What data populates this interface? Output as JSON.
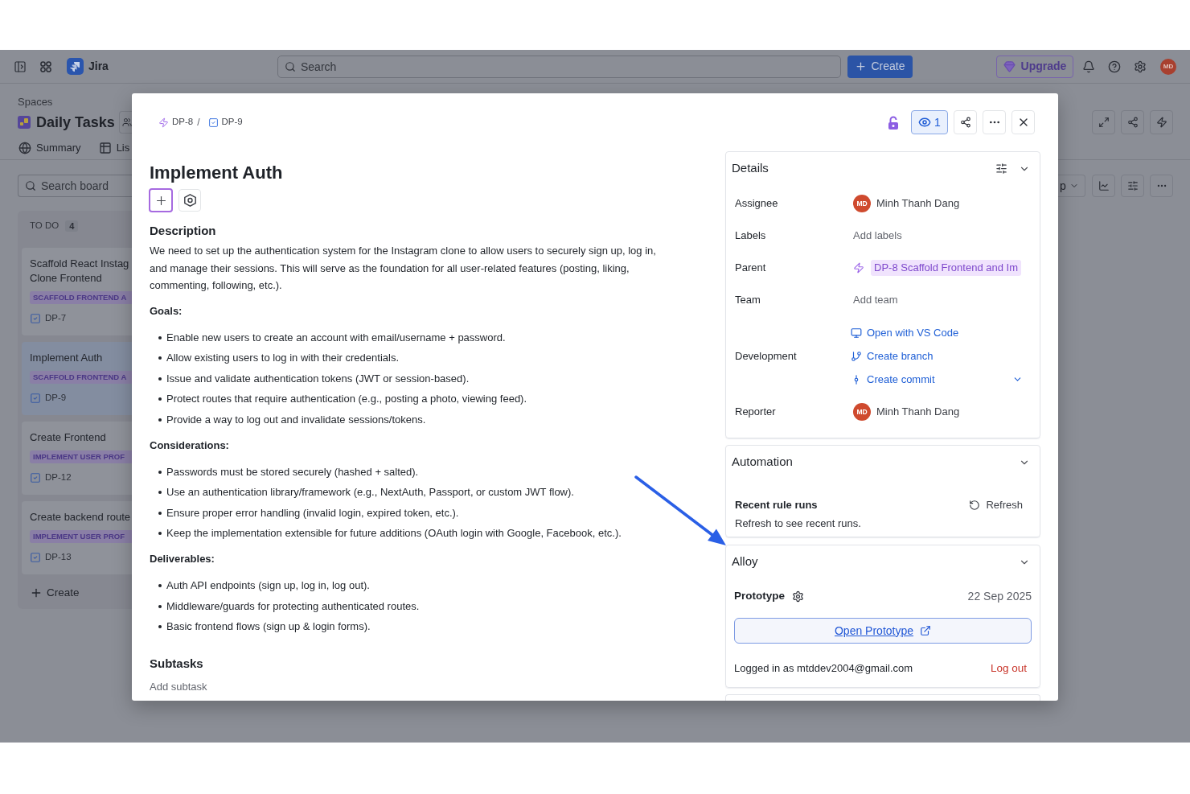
{
  "top_bar": {
    "product": "Jira",
    "search": {
      "placeholder": "Search"
    },
    "create_button": "Create",
    "upgrade_button": "Upgrade",
    "avatar": "MD"
  },
  "space_header": {
    "breadcrumb": "Spaces",
    "title": "Daily Tasks",
    "tabs": [
      {
        "label": "Summary",
        "selected": false
      },
      {
        "label": "Lis",
        "selected": false
      }
    ]
  },
  "board": {
    "search": {
      "placeholder": "Search board"
    },
    "column": {
      "title": "TO DO",
      "count": "4",
      "cards": [
        {
          "title_lines": [
            "Scaffold React Instag",
            "Clone Frontend"
          ],
          "tag": "SCAFFOLD FRONTEND A",
          "key": "DP-7",
          "selected": false
        },
        {
          "title_lines": [
            "Implement Auth"
          ],
          "tag": "SCAFFOLD FRONTEND A",
          "key": "DP-9",
          "selected": true
        },
        {
          "title_lines": [
            "Create Frontend"
          ],
          "tag": "IMPLEMENT USER PROF",
          "key": "DP-12",
          "selected": false
        },
        {
          "title_lines": [
            "Create backend route"
          ],
          "tag": "IMPLEMENT USER PROF",
          "key": "DP-13",
          "selected": false
        }
      ],
      "create_button": "Create"
    },
    "group_button": "p"
  },
  "issue": {
    "breadcrumb": [
      {
        "kind": "epic",
        "key": "DP-8"
      },
      {
        "kind": "task",
        "key": "DP-9"
      }
    ],
    "separator": "/",
    "watchers": "1",
    "title": "Implement Auth",
    "description": {
      "heading": "Description",
      "intro": "We need to set up the authentication system for the Instagram clone to allow users to securely sign up, log in, and manage their sessions. This will serve as the foundation for all user-related features (posting, liking, commenting, following, etc.).",
      "sections": [
        {
          "heading": "Goals:",
          "items": [
            "Enable new users to create an account with email/username + password.",
            "Allow existing users to log in with their credentials.",
            "Issue and validate authentication tokens (JWT or session-based).",
            "Protect routes that require authentication (e.g., posting a photo, viewing feed).",
            "Provide a way to log out and invalidate sessions/tokens."
          ]
        },
        {
          "heading": "Considerations:",
          "items": [
            "Passwords must be stored securely (hashed + salted).",
            "Use an authentication library/framework (e.g., NextAuth, Passport, or custom JWT flow).",
            "Ensure proper error handling (invalid login, expired token, etc.).",
            "Keep the implementation extensible for future additions (OAuth login with Google, Facebook, etc.)."
          ]
        },
        {
          "heading": "Deliverables:",
          "items": [
            "Auth API endpoints (sign up, log in, log out).",
            "Middleware/guards for protecting authenticated routes.",
            "Basic frontend flows (sign up & login forms)."
          ]
        }
      ]
    },
    "subtasks": {
      "heading": "Subtasks",
      "add_link": "Add subtask"
    },
    "details": {
      "title": "Details",
      "fields": [
        {
          "kind": "user",
          "label": "Assignee",
          "avatar": "MD",
          "value": "Minh Thanh Dang"
        },
        {
          "kind": "empty",
          "label": "Labels",
          "value": "Add labels"
        },
        {
          "kind": "parent",
          "label": "Parent",
          "value": "DP-8 Scaffold Frontend and Im"
        },
        {
          "kind": "empty",
          "label": "Team",
          "value": "Add team"
        },
        {
          "kind": "links",
          "label": "Development",
          "links": [
            {
              "kind": "ide",
              "text": "Open with VS Code"
            },
            {
              "kind": "branch",
              "text": "Create branch"
            },
            {
              "kind": "commit",
              "text": "Create commit"
            }
          ]
        },
        {
          "kind": "user",
          "label": "Reporter",
          "avatar": "MD",
          "value": "Minh Thanh Dang"
        }
      ]
    },
    "automation": {
      "title": "Automation",
      "subtitle": "Recent rule runs",
      "refresh_button": "Refresh",
      "note": "Refresh to see recent runs."
    },
    "alloy": {
      "title": "Alloy",
      "prototype_label": "Prototype",
      "date": "22 Sep 2025",
      "open_button": "Open Prototype",
      "login_text": "Logged in as mtddev2004@gmail.com",
      "logout_link": "Log out"
    }
  }
}
